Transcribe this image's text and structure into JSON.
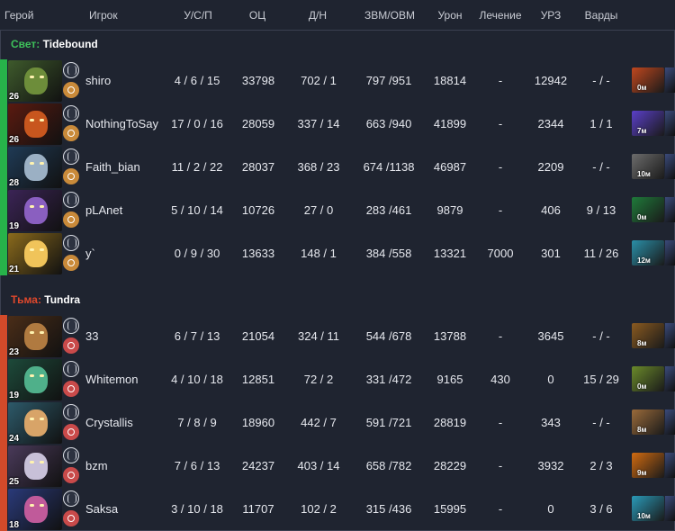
{
  "columns": {
    "hero": "Герой",
    "player": "Игрок",
    "kda": "У/С/П",
    "nw": "ОЦ",
    "lhdn": "Д/Н",
    "gpmxpm": "ЗВМ/ОВМ",
    "damage": "Урон",
    "heal": "Лечение",
    "tower": "УРЗ",
    "wards": "Варды"
  },
  "teams": [
    {
      "side": "Свет:",
      "name": "Tidebound",
      "side_color": "#3ec15a",
      "players": [
        {
          "level": "26",
          "player": "shiro",
          "kda": "4 / 6 / 15",
          "nw": "33798",
          "lhdn": "702 / 1",
          "gpmxpm": "797 /951",
          "damage": "18814",
          "heal": "-",
          "tower": "12942",
          "wards": "- / -",
          "item_time": "0м",
          "bar": "#27b24a",
          "bg": "#3e5a2c",
          "face": "#6d8d3a",
          "item": "#c0471e"
        },
        {
          "level": "26",
          "player": "NothingToSay",
          "kda": "17 / 0 / 16",
          "nw": "28059",
          "lhdn": "337 / 14",
          "gpmxpm": "663 /940",
          "damage": "41899",
          "heal": "-",
          "tower": "2344",
          "wards": "1 / 1",
          "item_time": "7м",
          "bar": "#27b24a",
          "bg": "#5a1a10",
          "face": "#c8561e",
          "item": "#5a3fc8"
        },
        {
          "level": "28",
          "player": "Faith_bian",
          "kda": "11 / 2 / 22",
          "nw": "28037",
          "lhdn": "368 / 23",
          "gpmxpm": "674 /1138",
          "damage": "46987",
          "heal": "-",
          "tower": "2209",
          "wards": "- / -",
          "item_time": "10м",
          "bar": "#27b24a",
          "bg": "#1f3a55",
          "face": "#9bb0c4",
          "item": "#6c6c6c"
        },
        {
          "level": "19",
          "player": "pLAnet",
          "kda": "5 / 10 / 14",
          "nw": "10726",
          "lhdn": "27 / 0",
          "gpmxpm": "283 /461",
          "damage": "9879",
          "heal": "-",
          "tower": "406",
          "wards": "9 / 13",
          "item_time": "0м",
          "bar": "#27b24a",
          "bg": "#3b2456",
          "face": "#8a5fc0",
          "item": "#1f7a3a"
        },
        {
          "level": "21",
          "player": "y`",
          "kda": "0 / 9 / 30",
          "nw": "13633",
          "lhdn": "148 / 1",
          "gpmxpm": "384 /558",
          "damage": "13321",
          "heal": "7000",
          "tower": "301",
          "wards": "11 / 26",
          "item_time": "12м",
          "bar": "#27b24a",
          "bg": "#8a6a1c",
          "face": "#f0c45a",
          "item": "#2a8fa8"
        }
      ]
    },
    {
      "side": "Тьма:",
      "name": "Tundra",
      "side_color": "#e0482c",
      "players": [
        {
          "level": "23",
          "player": "33",
          "kda": "6 / 7 / 13",
          "nw": "21054",
          "lhdn": "324 / 11",
          "gpmxpm": "544 /678",
          "damage": "13788",
          "heal": "-",
          "tower": "3645",
          "wards": "- / -",
          "item_time": "8м",
          "bar": "#d24a2a",
          "bg": "#4a2d18",
          "face": "#b07a40",
          "item": "#8a5a20"
        },
        {
          "level": "19",
          "player": "Whitemon",
          "kda": "4 / 10 / 18",
          "nw": "12851",
          "lhdn": "72 / 2",
          "gpmxpm": "331 /472",
          "damage": "9165",
          "heal": "430",
          "tower": "0",
          "wards": "15 / 29",
          "item_time": "0м",
          "bar": "#d24a2a",
          "bg": "#1d4a3a",
          "face": "#4fb08a",
          "item": "#6a8a2a"
        },
        {
          "level": "24",
          "player": "Crystallis",
          "kda": "7 / 8 / 9",
          "nw": "18960",
          "lhdn": "442 / 7",
          "gpmxpm": "591 /721",
          "damage": "28819",
          "heal": "-",
          "tower": "343",
          "wards": "- / -",
          "item_time": "8м",
          "bar": "#d24a2a",
          "bg": "#2d5a6a",
          "face": "#d8a468",
          "item": "#9a6a3a"
        },
        {
          "level": "25",
          "player": "bzm",
          "kda": "7 / 6 / 13",
          "nw": "24237",
          "lhdn": "403 / 14",
          "gpmxpm": "658 /782",
          "damage": "28229",
          "heal": "-",
          "tower": "3932",
          "wards": "2 / 3",
          "item_time": "9м",
          "bar": "#d24a2a",
          "bg": "#4a3a5a",
          "face": "#c8c0d8",
          "item": "#d06a10"
        },
        {
          "level": "18",
          "player": "Saksa",
          "kda": "3 / 10 / 18",
          "nw": "11707",
          "lhdn": "102 / 2",
          "gpmxpm": "315 /436",
          "damage": "15995",
          "heal": "-",
          "tower": "0",
          "wards": "3 / 6",
          "item_time": "10м",
          "bar": "#d24a2a",
          "bg": "#2a3a7a",
          "face": "#c05a9a",
          "item": "#2a9ab8"
        }
      ]
    }
  ]
}
